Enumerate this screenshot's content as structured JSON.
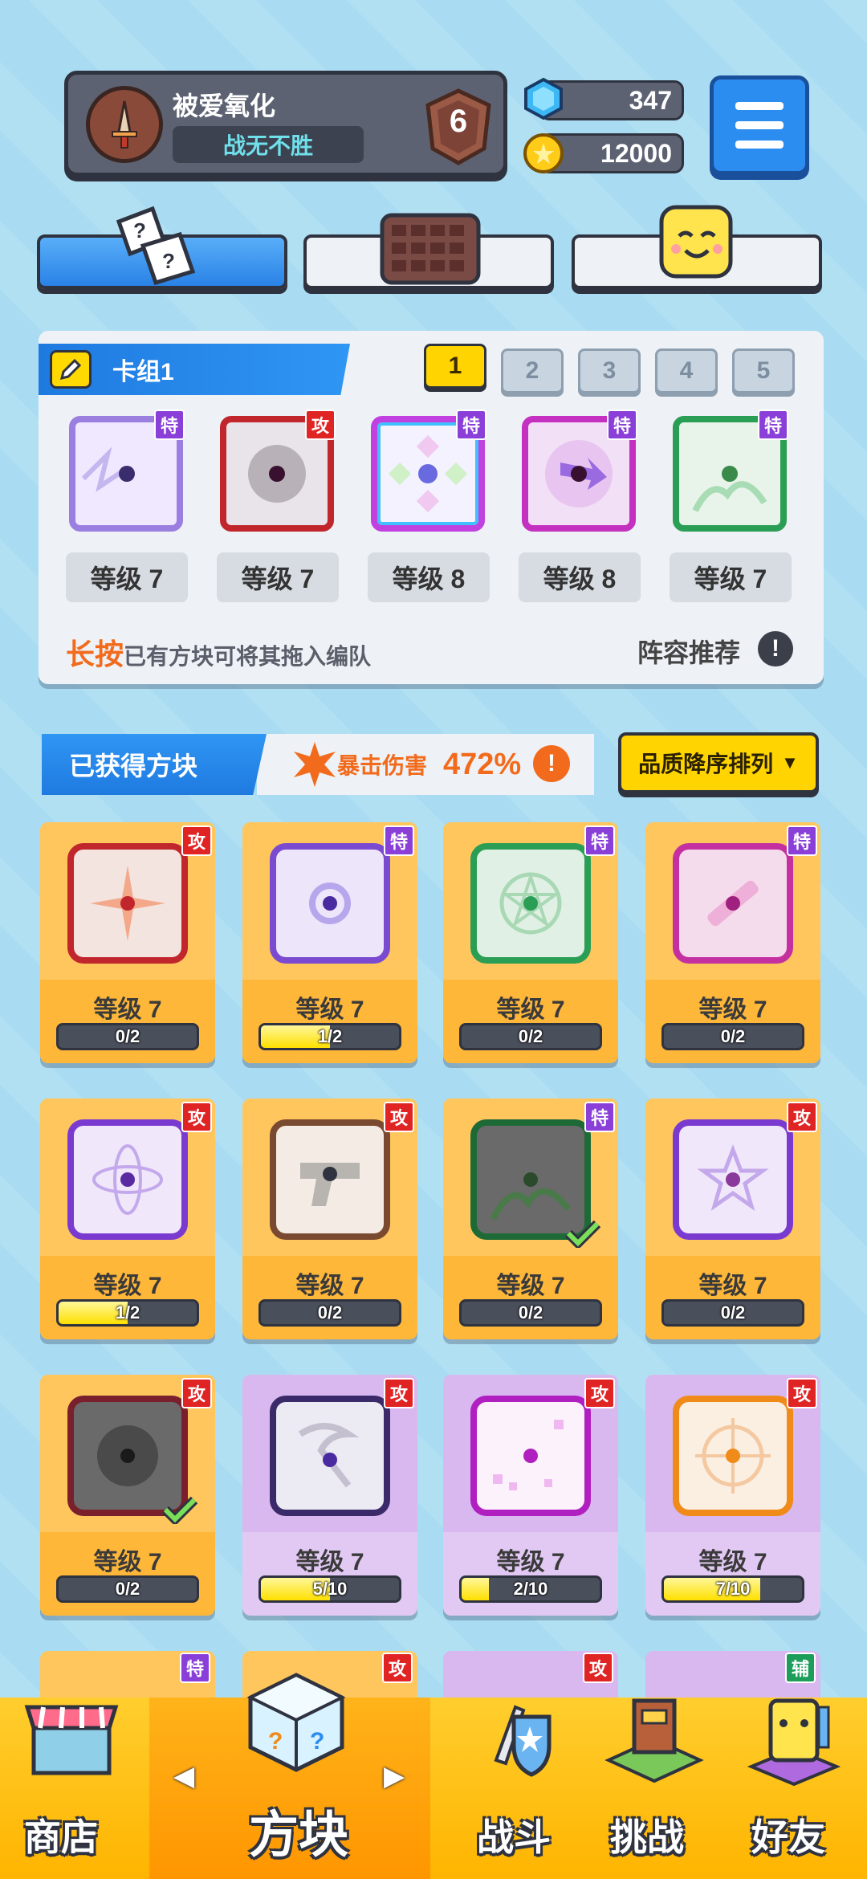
{
  "profile": {
    "name": "被爱氧化",
    "title": "战无不胜",
    "rank": "6"
  },
  "currency": {
    "gems": "347",
    "coins": "12000"
  },
  "deck": {
    "title": "卡组1",
    "tabs": [
      "1",
      "2",
      "3",
      "4",
      "5"
    ],
    "active_tab": "1",
    "cards": [
      {
        "tag": "特",
        "level": "等级 7"
      },
      {
        "tag": "攻",
        "level": "等级 7"
      },
      {
        "tag": "特",
        "level": "等级 8"
      },
      {
        "tag": "特",
        "level": "等级 8"
      },
      {
        "tag": "特",
        "level": "等级 7"
      }
    ],
    "hint_key": "长按",
    "hint_rest": "已有方块可将其拖入编队",
    "recommend": "阵容推荐",
    "excl": "!"
  },
  "owned": {
    "title": "已获得方块",
    "crit_label": "暴击伤害",
    "crit_value": "472%",
    "sort_label": "品质降序排列",
    "sort_arrow": "▼"
  },
  "grid": [
    {
      "tag": "攻",
      "level": "等级 7",
      "progress": "0/2",
      "fill": 0.0
    },
    {
      "tag": "特",
      "level": "等级 7",
      "progress": "1/2",
      "fill": 0.5
    },
    {
      "tag": "特",
      "level": "等级 7",
      "progress": "0/2",
      "fill": 0.0
    },
    {
      "tag": "特",
      "level": "等级 7",
      "progress": "0/2",
      "fill": 0.0
    },
    {
      "tag": "攻",
      "level": "等级 7",
      "progress": "1/2",
      "fill": 0.5
    },
    {
      "tag": "攻",
      "level": "等级 7",
      "progress": "0/2",
      "fill": 0.0
    },
    {
      "tag": "特",
      "level": "等级 7",
      "progress": "0/2",
      "fill": 0.0
    },
    {
      "tag": "攻",
      "level": "等级 7",
      "progress": "0/2",
      "fill": 0.0
    },
    {
      "tag": "攻",
      "level": "等级 7",
      "progress": "0/2",
      "fill": 0.0
    },
    {
      "tag": "攻",
      "level": "等级 7",
      "progress": "5/10",
      "fill": 0.5
    },
    {
      "tag": "攻",
      "level": "等级 7",
      "progress": "2/10",
      "fill": 0.2
    },
    {
      "tag": "攻",
      "level": "等级 7",
      "progress": "7/10",
      "fill": 0.7
    }
  ],
  "peek_tags": [
    "特",
    "攻",
    "攻",
    "辅"
  ],
  "nav": {
    "shop": "商店",
    "blocks": "方块",
    "battle": "战斗",
    "challenge": "挑战",
    "friends": "好友",
    "left_arrow": "◀",
    "right_arrow": "▶"
  },
  "colors": {
    "background": "#a9dcf2",
    "accent_blue": "#2c8df0",
    "accent_yellow": "#ffd400",
    "attack_tag": "#e02424",
    "special_tag": "#8a3fd8",
    "support_tag": "#1c9e5a"
  },
  "icons": {
    "avatar": "sword-shield-icon",
    "gem": "gem-icon",
    "coin": "coin-icon",
    "menu": "hamburger-menu-icon",
    "tab_dice": "dice-icon",
    "tab_board": "grid-board-icon",
    "tab_face": "smiley-block-icon"
  }
}
